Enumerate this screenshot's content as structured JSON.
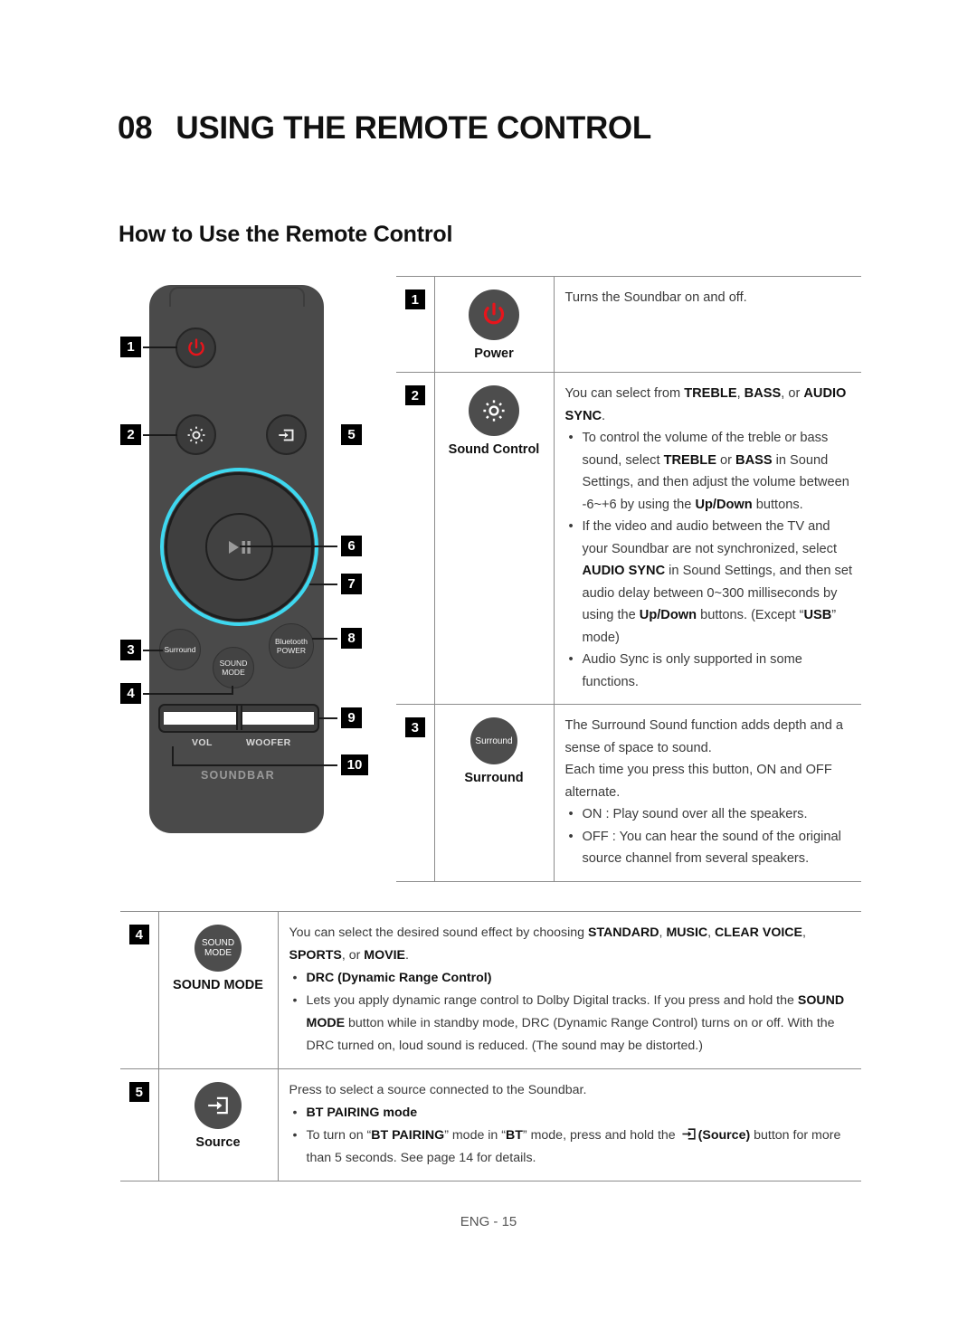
{
  "header": {
    "chapter_number": "08",
    "chapter_title": "USING THE REMOTE CONTROL",
    "section_title": "How to Use the Remote Control"
  },
  "remote": {
    "labels": {
      "surround": "Surround",
      "bluetooth_line1": "Bluetooth",
      "bluetooth_line2": "POWER",
      "sound_mode_line1": "SOUND",
      "sound_mode_line2": "MODE",
      "vol": "VOL",
      "woofer": "WOOFER",
      "brand": "SOUNDBAR",
      "playpause": "▶❙❙"
    },
    "callouts": [
      "1",
      "2",
      "3",
      "4",
      "5",
      "6",
      "7",
      "8",
      "9",
      "10"
    ],
    "colors": {
      "body": "#4a4a4a",
      "ring_accent": "#3ed8f0",
      "power_accent": "#e8141b"
    }
  },
  "table_top": [
    {
      "num": "1",
      "icon_name": "power-icon",
      "caption": "Power",
      "lines": [
        {
          "type": "para",
          "parts": [
            {
              "t": "Turns the Soundbar on and off."
            }
          ]
        }
      ]
    },
    {
      "num": "2",
      "icon_name": "gear-icon",
      "caption": "Sound Control",
      "lines": [
        {
          "type": "para",
          "parts": [
            {
              "t": "You can select from "
            },
            {
              "t": "TREBLE",
              "b": true
            },
            {
              "t": ", "
            },
            {
              "t": "BASS",
              "b": true
            },
            {
              "t": ", or "
            },
            {
              "t": "AUDIO SYNC",
              "b": true
            },
            {
              "t": "."
            }
          ]
        },
        {
          "type": "bullet",
          "parts": [
            {
              "t": "To control the volume of the treble or bass sound, select "
            },
            {
              "t": "TREBLE",
              "b": true
            },
            {
              "t": " or "
            },
            {
              "t": "BASS",
              "b": true
            },
            {
              "t": " in Sound Settings, and then adjust the volume between -6~+6 by using the "
            },
            {
              "t": "Up/Down",
              "b": true
            },
            {
              "t": " buttons."
            }
          ]
        },
        {
          "type": "bullet",
          "parts": [
            {
              "t": "If the video and audio between the TV and your Soundbar are not synchronized, select "
            },
            {
              "t": "AUDIO SYNC",
              "b": true
            },
            {
              "t": " in Sound Settings, and then set audio delay between 0~300 milliseconds by using the "
            },
            {
              "t": "Up/Down",
              "b": true
            },
            {
              "t": " buttons. (Except “"
            },
            {
              "t": "USB",
              "b": true
            },
            {
              "t": "” mode)"
            }
          ]
        },
        {
          "type": "bullet",
          "parts": [
            {
              "t": "Audio Sync is only supported in some functions."
            }
          ]
        }
      ]
    },
    {
      "num": "3",
      "icon_name": "surround-icon",
      "icon_text": "Surround",
      "caption": "Surround",
      "lines": [
        {
          "type": "para",
          "parts": [
            {
              "t": "The Surround Sound function adds depth and a sense of space to sound."
            }
          ]
        },
        {
          "type": "para",
          "parts": [
            {
              "t": "Each time you press this button, ON and OFF alternate."
            }
          ]
        },
        {
          "type": "bullet",
          "parts": [
            {
              "t": "ON : Play sound over all the speakers."
            }
          ]
        },
        {
          "type": "bullet",
          "parts": [
            {
              "t": "OFF : You can hear the sound of the original source channel from several speakers."
            }
          ]
        }
      ]
    }
  ],
  "table_bottom": [
    {
      "num": "4",
      "icon_name": "sound-mode-icon",
      "icon_line1": "SOUND",
      "icon_line2": "MODE",
      "caption": "SOUND MODE",
      "lines": [
        {
          "type": "para",
          "parts": [
            {
              "t": "You can select the desired sound effect by choosing "
            },
            {
              "t": "STANDARD",
              "b": true
            },
            {
              "t": ", "
            },
            {
              "t": "MUSIC",
              "b": true
            },
            {
              "t": ", "
            },
            {
              "t": "CLEAR VOICE",
              "b": true
            },
            {
              "t": ", "
            },
            {
              "t": "SPORTS",
              "b": true
            },
            {
              "t": ", or "
            },
            {
              "t": "MOVIE",
              "b": true
            },
            {
              "t": "."
            }
          ]
        },
        {
          "type": "bullet",
          "parts": [
            {
              "t": "DRC (Dynamic Range Control)",
              "b": true
            }
          ]
        },
        {
          "type": "sub",
          "parts": [
            {
              "t": "Lets you apply dynamic range control to Dolby Digital tracks. If you press and hold the "
            },
            {
              "t": "SOUND MODE",
              "b": true
            },
            {
              "t": " button while in standby mode, DRC (Dynamic Range Control) turns on or off. With the DRC turned on, loud sound is reduced. (The sound may be distorted.)"
            }
          ]
        }
      ]
    },
    {
      "num": "5",
      "icon_name": "source-icon",
      "caption": "Source",
      "lines": [
        {
          "type": "para",
          "parts": [
            {
              "t": "Press to select a source connected to the Soundbar."
            }
          ]
        },
        {
          "type": "bullet",
          "parts": [
            {
              "t": "BT PAIRING mode",
              "b": true
            }
          ]
        },
        {
          "type": "sub",
          "parts": [
            {
              "t": "To turn on “"
            },
            {
              "t": "BT PAIRING",
              "b": true
            },
            {
              "t": "” mode in “"
            },
            {
              "t": "BT",
              "b": true
            },
            {
              "t": "” mode, press and hold the "
            },
            {
              "t": "__SOURCE_ICON__",
              "icon": true
            },
            {
              "t": "(Source)",
              "b": true
            },
            {
              "t": " button for more than 5 seconds. See page 14 for details."
            }
          ]
        }
      ]
    }
  ],
  "footer": {
    "page_label": "ENG - 15"
  }
}
